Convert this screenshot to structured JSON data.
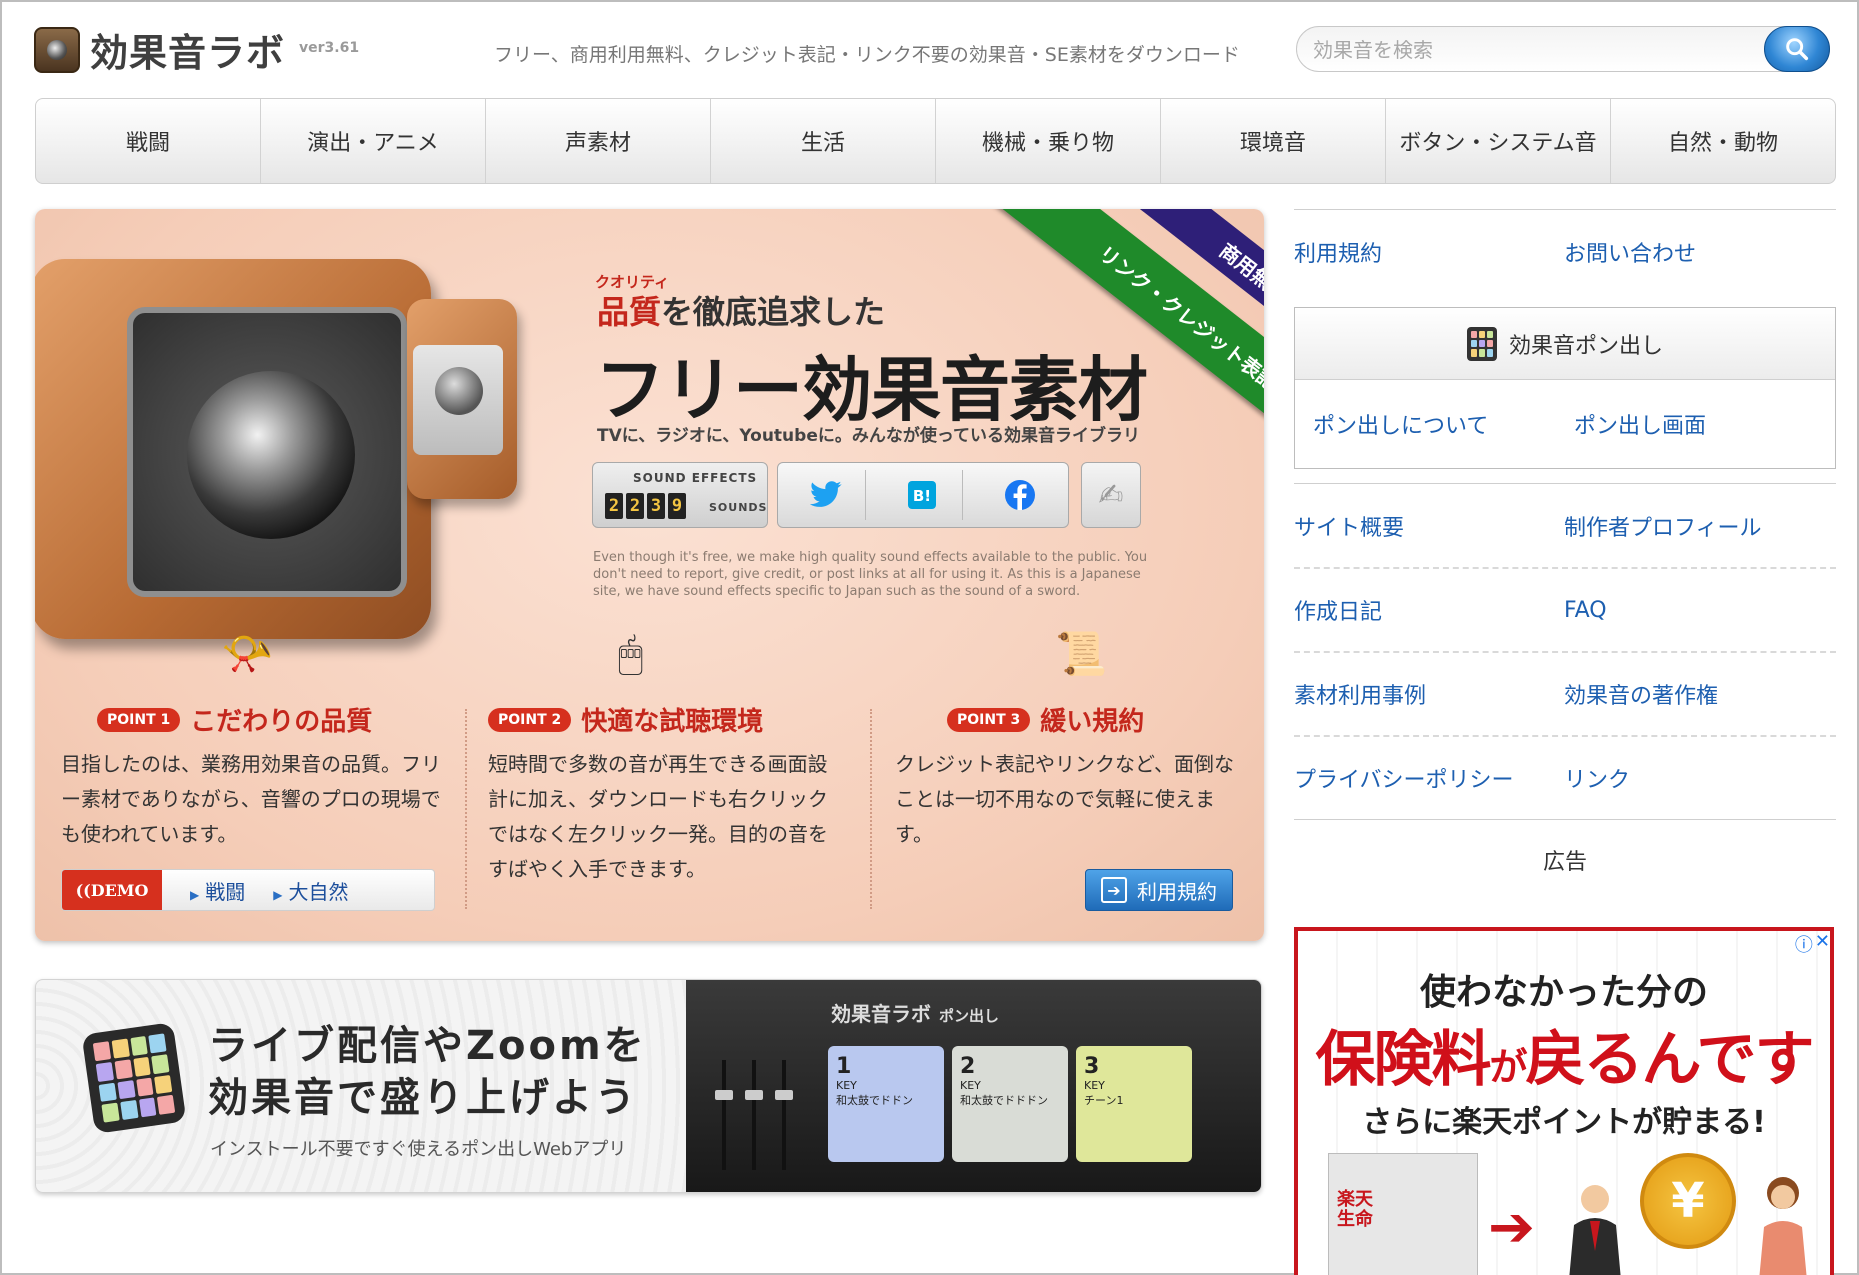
{
  "header": {
    "logo_text": "効果音ラボ",
    "version": "ver3.61",
    "tagline": "フリー、商用利用無料、クレジット表記・リンク不要の効果音・SE素材をダウンロード",
    "search_placeholder": "効果音を検索"
  },
  "nav": {
    "items": [
      "戦闘",
      "演出・アニメ",
      "声素材",
      "生活",
      "機械・乗り物",
      "環境音",
      "ボタン・システム音",
      "自然・動物"
    ]
  },
  "hero": {
    "ruby": "クオリティ",
    "subtitle_red": "品質",
    "subtitle_rest": "を徹底追求した",
    "title": "フリー効果音素材",
    "description": "TVに、ラジオに、Youtubeに。みんなが使っている効果音ライブラリ",
    "stats_label": "SOUND EFFECTS",
    "stats_digits": [
      "2",
      "2",
      "3",
      "9"
    ],
    "stats_unit": "SOUNDS",
    "english_note": "Even though it's free, we make high quality sound effects available to the public. You don't need to report, give credit, or post links at all for using it. As this is a Japanese site, we have sound effects specific to Japan such as the sound of a sword.",
    "ribbon_top": "商用無料",
    "ribbon_bottom": "リンク・クレジット表記不要",
    "points": [
      {
        "badge": "POINT 1",
        "title": "こだわりの品質",
        "body": "目指したのは、業務用効果音の品質。フリー素材でありながら、音響のプロの現場でも使われています。"
      },
      {
        "badge": "POINT 2",
        "title": "快適な試聴環境",
        "body": "短時間で多数の音が再生できる画面設計に加え、ダウンロードも右クリックではなく左クリック一発。目的の音をすばやく入手できます。"
      },
      {
        "badge": "POINT 3",
        "title": "緩い規約",
        "body": "クレジット表記やリンクなど、面倒なことは一切不用なので気軽に使えます。"
      }
    ],
    "demo_label": "((DEMO",
    "demo_links": [
      "戦闘",
      "大自然"
    ],
    "terms_button": "利用規約"
  },
  "live_banner": {
    "title_line1": "ライブ配信やZoomを",
    "title_line2": "効果音で盛り上げよう",
    "subtitle": "インストール不要ですぐ使えるポン出しWebアプリ",
    "app_title": "効果音ラボ",
    "app_title_suffix": "ポン出し",
    "pads": [
      {
        "key": "1",
        "sub": "KEY",
        "label": "和太鼓でドドン",
        "color": "blue"
      },
      {
        "key": "2",
        "sub": "KEY",
        "label": "和太鼓でドドドン",
        "color": "gray"
      },
      {
        "key": "3",
        "sub": "KEY",
        "label": "チーン1",
        "color": "yellow"
      }
    ]
  },
  "sidebar": {
    "top_links": [
      "利用規約",
      "お問い合わせ"
    ],
    "pon_title": "効果音ポン出し",
    "pon_links": [
      "ポン出しについて",
      "ポン出し画面"
    ],
    "links": [
      [
        "サイト概要",
        "制作者プロフィール"
      ],
      [
        "作成日記",
        "FAQ"
      ],
      [
        "素材利用事例",
        "効果音の著作権"
      ],
      [
        "プライバシーポリシー",
        "リンク"
      ]
    ],
    "ad_label": "広告"
  },
  "ad": {
    "line1": "使わなかった分の",
    "line2_a": "保険料",
    "line2_b": "が",
    "line2_c": "戻るんです",
    "line3": "さらに楽天ポイントが貯まる!",
    "building_label": "楽天生命",
    "coin_symbol": "¥",
    "info_icon": "ⓘ",
    "close_icon": "✕"
  },
  "colors": {
    "accent_red": "#c4271c",
    "link_blue": "#1d5fb0",
    "ribbon_green": "#1f8a2a",
    "ribbon_purple": "#2e1f78"
  }
}
